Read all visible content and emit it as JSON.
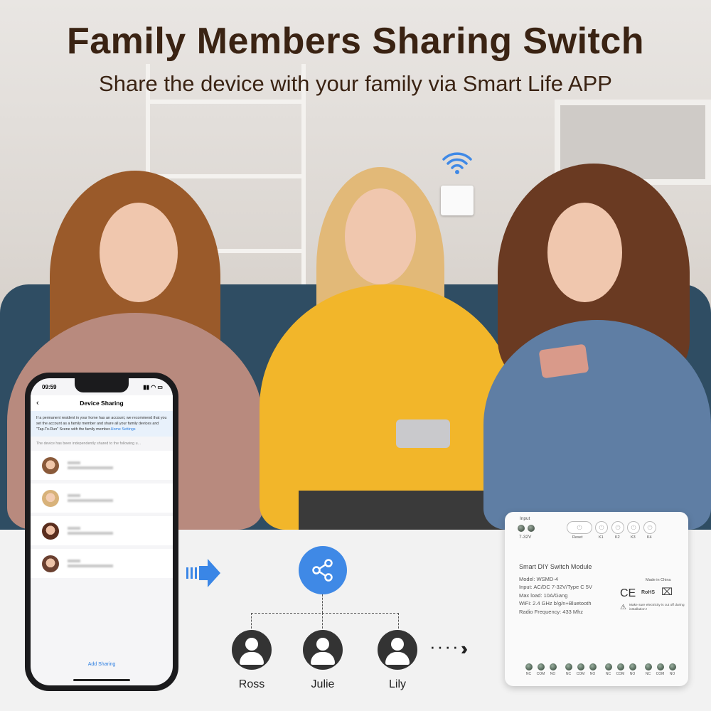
{
  "headline": "Family Members Sharing Switch",
  "subheadline": "Share the device with your family via Smart Life APP",
  "phone": {
    "time": "09:59",
    "title": "Device Sharing",
    "info_text": "If a permanent resident in your home has an account, we recommend that you set the account as a family member and share all your family devices and \"Tap-To-Run\" Scene with the family member.",
    "info_link": "Home Settings",
    "shared_text": "The device has been independently shared to the following u...",
    "contacts_count": 4,
    "add_sharing": "Add Sharing"
  },
  "colors": {
    "accent": "#3f89e6",
    "title": "#3a2313"
  },
  "share_icon": "share-icon",
  "users": [
    {
      "name": "Ross"
    },
    {
      "name": "Julie"
    },
    {
      "name": "Lily"
    }
  ],
  "module": {
    "input_label": "Input",
    "voltage": "7-32V",
    "buttons": [
      "Reset",
      "K1",
      "K2",
      "K3",
      "K4"
    ],
    "title": "Smart DIY Switch Module",
    "specs": [
      "Model: WSMD-4",
      "Input: AC/DC 7-32V/Type C 5V",
      "Max load: 10A/Gang",
      "WiFi: 2.4 GHz b/g/n+Bluetooth",
      "Radio Frequency: 433 Mhz"
    ],
    "made_in": "Made in China",
    "warning": "Make sure electricity is cut off during installation !",
    "relays": [
      "NC",
      "COM",
      "NO",
      "NC",
      "COM",
      "NO",
      "NC",
      "COM",
      "NO",
      "NC",
      "COM",
      "NO"
    ]
  }
}
